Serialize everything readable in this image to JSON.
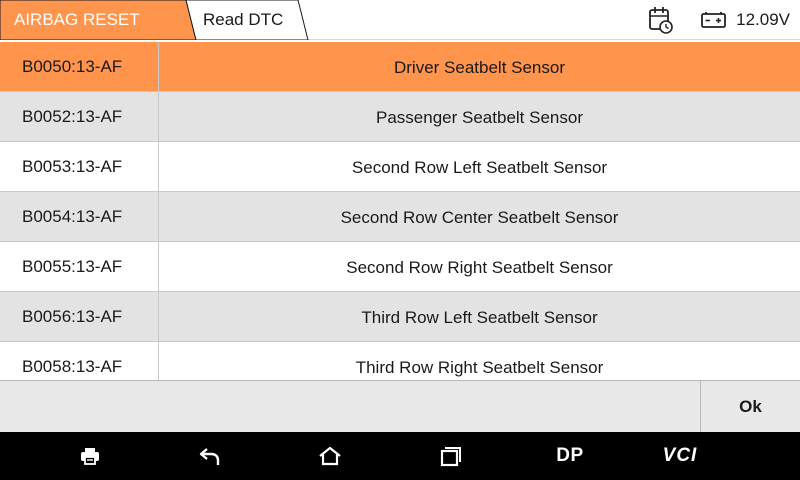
{
  "header": {
    "breadcrumbs": [
      "AIRBAG RESET",
      "Read DTC"
    ],
    "voltage": "12.09V",
    "icons": [
      "calendar-clock-icon",
      "battery-icon"
    ],
    "accent_color": "#ff944d"
  },
  "dtc_list": {
    "selected_index": 0,
    "rows": [
      {
        "code": "B0050:13-AF",
        "description": "Driver Seatbelt Sensor"
      },
      {
        "code": "B0052:13-AF",
        "description": "Passenger Seatbelt Sensor"
      },
      {
        "code": "B0053:13-AF",
        "description": "Second Row Left Seatbelt Sensor"
      },
      {
        "code": "B0054:13-AF",
        "description": "Second Row Center Seatbelt Sensor"
      },
      {
        "code": "B0055:13-AF",
        "description": "Second Row Right Seatbelt Sensor"
      },
      {
        "code": "B0056:13-AF",
        "description": "Third Row Left Seatbelt Sensor"
      },
      {
        "code": "B0058:13-AF",
        "description": "Third Row Right Seatbelt Sensor"
      }
    ]
  },
  "action_bar": {
    "ok_label": "Ok"
  },
  "nav_bar": {
    "items": [
      {
        "name": "print-icon"
      },
      {
        "name": "back-icon"
      },
      {
        "name": "home-icon"
      },
      {
        "name": "recent-apps-icon"
      },
      {
        "label": "DP"
      },
      {
        "label": "VCI"
      }
    ]
  }
}
